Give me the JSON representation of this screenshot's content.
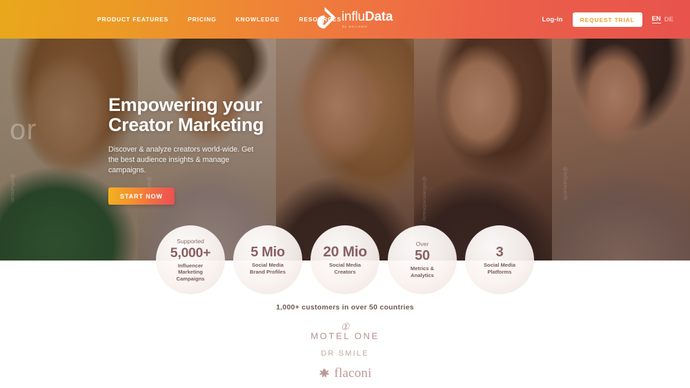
{
  "brand": {
    "colors": {
      "header_gradient_start": "#e9a81b",
      "header_gradient_end": "#e8534c",
      "cta_gradient_start": "#f3b21d",
      "cta_gradient_end": "#ed4f52",
      "stat_text": "#8a5f60",
      "customer_logo": "#b4938f"
    }
  },
  "header": {
    "nav": [
      {
        "label": "PRODUCT FEATURES",
        "name": "product-features"
      },
      {
        "label": "PRICING",
        "name": "pricing"
      },
      {
        "label": "KNOWLEDGE",
        "name": "knowledge"
      },
      {
        "label": "RESOURCES",
        "name": "resources"
      }
    ],
    "logo": {
      "text_light": "influ",
      "text_bold": "Data",
      "tagline": "by wecreate",
      "icon": "infludata-pin-logo"
    },
    "login_label": "Log-in",
    "trial_label": "REQUEST TRIAL",
    "lang_active": "EN",
    "lang_inactive": "DE"
  },
  "hero": {
    "title_line1": "Empowering your",
    "title_line2": "Creator Marketing",
    "subtitle": "Discover & analyze creators world-wide. Get the best audience insights & manage campaigns.",
    "cta_label": "START NOW",
    "background_text": "or",
    "watermarks": [
      "@influencer",
      "@influencer",
      "@influencerbeauty",
      "@influencerfit"
    ]
  },
  "stats": [
    {
      "pre": "Supported",
      "number": "5,000+",
      "label_line1": "Influencer",
      "label_line2": "Marketing",
      "label_line3": "Campaigns"
    },
    {
      "pre": "",
      "number": "5 Mio",
      "label_line1": "Social Media",
      "label_line2": "Brand Profiles",
      "label_line3": ""
    },
    {
      "pre": "",
      "number": "20 Mio",
      "label_line1": "Social Media",
      "label_line2": "Creators",
      "label_line3": ""
    },
    {
      "pre": "Over",
      "number": "50",
      "label_line1": "Metrics &",
      "label_line2": "Analytics",
      "label_line3": ""
    },
    {
      "pre": "",
      "number": "3",
      "label_line1": "Social Media",
      "label_line2": "Platforms",
      "label_line3": ""
    }
  ],
  "customers": {
    "heading": "1,000+ customers in over 50 countries",
    "logos": [
      {
        "name": "motel-one",
        "mark": "①",
        "word": "Motel One"
      },
      {
        "name": "dr-smile",
        "word": "DR SMILE"
      },
      {
        "name": "flaconi",
        "word": "flaconi"
      }
    ]
  }
}
